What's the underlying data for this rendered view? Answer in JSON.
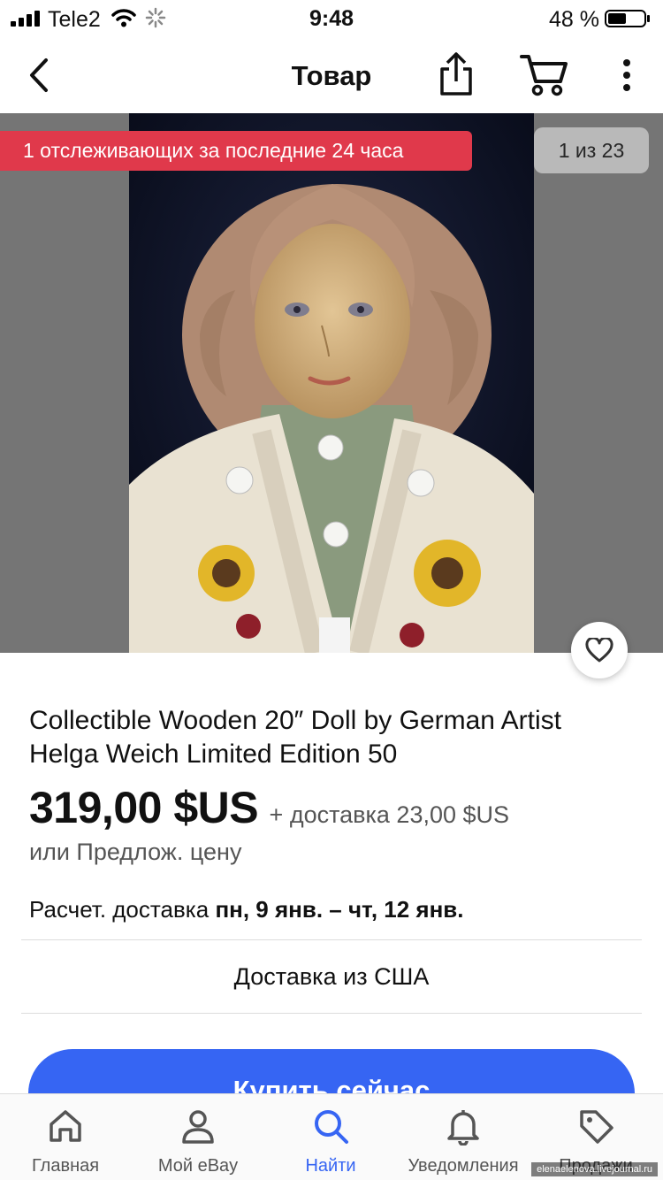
{
  "status_bar": {
    "carrier": "Tele2",
    "time": "9:48",
    "battery": "48 %",
    "icons": [
      "signal-icon",
      "wifi-icon",
      "activity-spinner-icon",
      "battery-icon"
    ]
  },
  "nav": {
    "title": "Товар",
    "icons": [
      "back-icon",
      "share-icon",
      "cart-icon",
      "more-icon"
    ]
  },
  "gallery": {
    "watchers_badge": "1 отслеживающих за последние 24 часа",
    "counter": "1 из 23",
    "photo_alt": "doll-photo"
  },
  "item": {
    "title": "Collectible Wooden 20″ Doll by German Artist Helga Weich Limited Edition 50",
    "price": "319,00 $US",
    "shipping_cost": "+ доставка 23,00 $US",
    "best_offer": "или Предлож. цену",
    "delivery_label": "Расчет. доставка",
    "delivery_dates": "пн, 9 янв. – чт, 12 янв.",
    "ships_from": "Доставка из США",
    "buy_button": "Купить сейчас"
  },
  "tab_bar": {
    "tabs": [
      {
        "label": "Главная",
        "icon": "home-icon",
        "active": false
      },
      {
        "label": "Мой eBay",
        "icon": "user-icon",
        "active": false
      },
      {
        "label": "Найти",
        "icon": "search-icon",
        "active": true
      },
      {
        "label": "Уведомления",
        "icon": "bell-icon",
        "active": false
      },
      {
        "label": "Продажи",
        "icon": "tag-icon",
        "active": false
      }
    ]
  },
  "watermark": "elenaelenova.livejournal.ru",
  "colors": {
    "accent": "#3665f3",
    "badge_red": "#e0394b",
    "gallery_bg": "#757575"
  }
}
